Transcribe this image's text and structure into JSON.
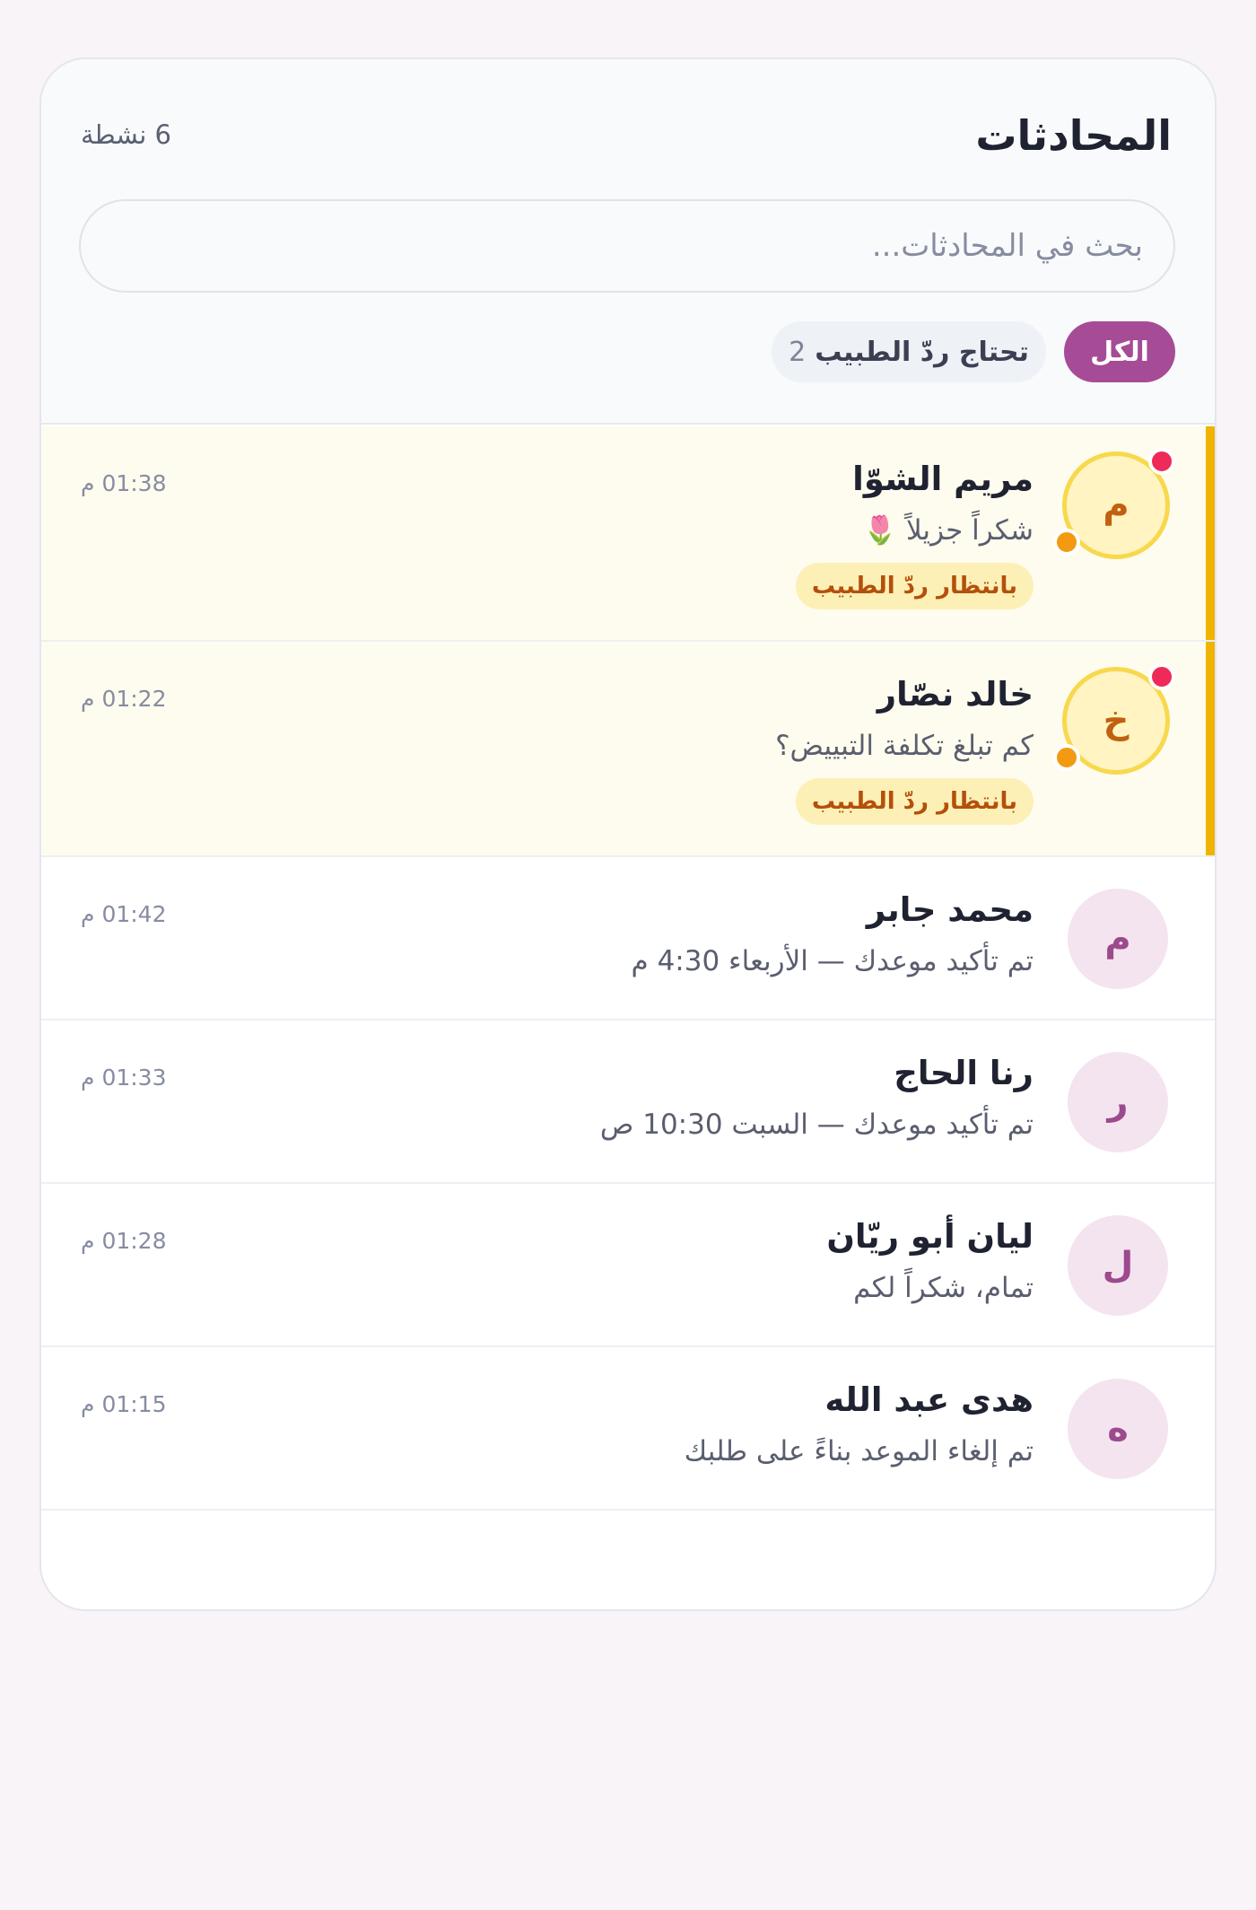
{
  "header": {
    "title": "المحادثات",
    "active_count": "6 نشطة"
  },
  "search": {
    "placeholder": "بحث في المحادثات..."
  },
  "filters": {
    "all_label": "الكل",
    "needs_reply_label": "تحتاج ردّ الطبيب",
    "needs_reply_count": "2"
  },
  "conversations": [
    {
      "name": "مريم الشوّا",
      "initial": "م",
      "preview": "شكراً جزيلاً",
      "preview_emoji": "🌷",
      "time": "01:38 م",
      "badge": "بانتظار ردّ الطبيب"
    },
    {
      "name": "خالد نصّار",
      "initial": "خ",
      "preview": "كم تبلغ تكلفة التبييض؟",
      "time": "01:22 م",
      "badge": "بانتظار ردّ الطبيب"
    },
    {
      "name": "محمد جابر",
      "initial": "م",
      "preview": "تم تأكيد موعدك — الأربعاء 4:30 م",
      "time": "01:42 م"
    },
    {
      "name": "رنا الحاج",
      "initial": "ر",
      "preview": "تم تأكيد موعدك — السبت 10:30 ص",
      "time": "01:33 م"
    },
    {
      "name": "ليان أبو ريّان",
      "initial": "ل",
      "preview": "تمام، شكراً لكم",
      "time": "01:28 م"
    },
    {
      "name": "هدى عبد الله",
      "initial": "ه",
      "preview": "تم إلغاء الموعد بناءً على طلبك",
      "time": "01:15 م"
    }
  ],
  "colors": {
    "accent": "#a64c97",
    "pending_bar": "#f0b400",
    "unread_dot": "#ef2a58",
    "status_dot": "#f39a12"
  }
}
